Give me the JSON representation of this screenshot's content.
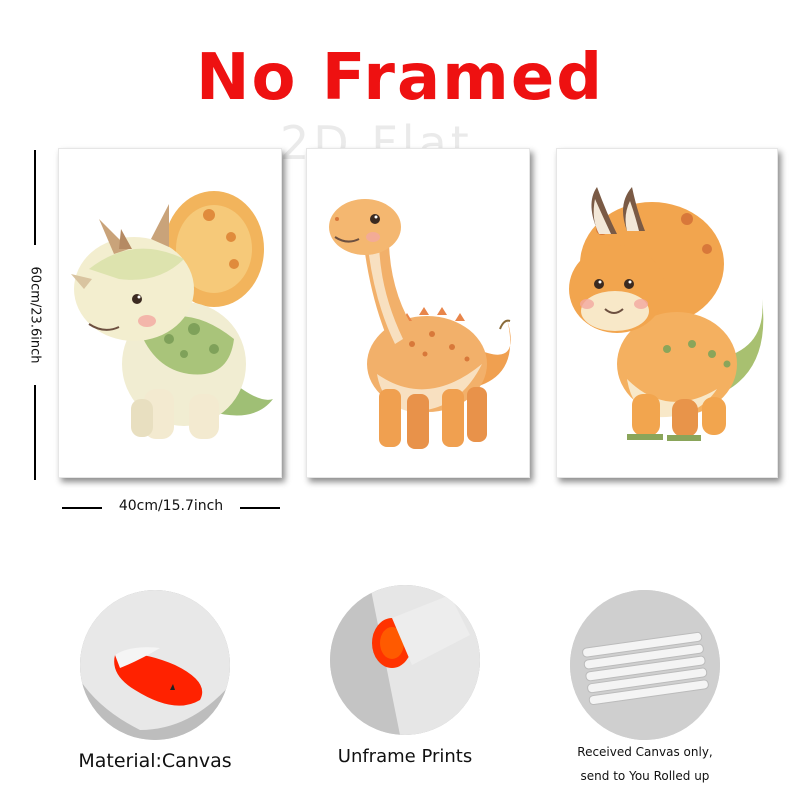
{
  "title": "No Framed",
  "watermark": "2D Flat",
  "dimensions": {
    "height": "60cm/23.6inch",
    "width": "40cm/15.7inch"
  },
  "features": [
    {
      "caption": "Material:Canvas"
    },
    {
      "caption": "Unframe  Prints"
    },
    {
      "caption_line1": "Received Canvas only,",
      "caption_line2": "send to You Rolled up"
    }
  ],
  "colors": {
    "title": "#ee1111",
    "canvas_back": "#ff2200",
    "dino_orange": "#f0a050",
    "dino_green": "#a8c070"
  },
  "prints": [
    {
      "subject": "triceratops-green"
    },
    {
      "subject": "brachiosaurus-orange"
    },
    {
      "subject": "triceratops-orange"
    }
  ]
}
